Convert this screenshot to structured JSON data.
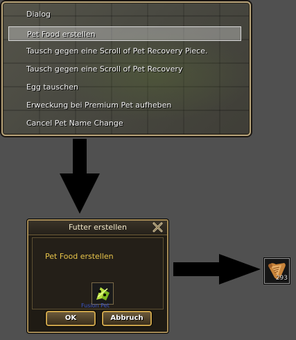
{
  "menu": {
    "items": [
      {
        "label": "Dialog",
        "selected": false
      },
      {
        "label": "Pet Food erstellen",
        "selected": true
      },
      {
        "label": "Tausch gegen eine Scroll of Pet Recovery Piece.",
        "selected": false
      },
      {
        "label": "Tausch gegen eine Scroll of Pet Recovery",
        "selected": false
      },
      {
        "label": "Egg tauschen",
        "selected": false
      },
      {
        "label": "Erweckung bei Premium Pet aufheben",
        "selected": false
      },
      {
        "label": "Cancel Pet Name Change",
        "selected": false
      }
    ]
  },
  "dialog": {
    "title": "Futter erstellen",
    "text": "Pet Food erstellen",
    "item_name": "Fusion Pet",
    "ok_label": "OK",
    "cancel_label": "Abbruch",
    "close_icon": "close-x-icon"
  },
  "result": {
    "icon": "scroll-icon",
    "count": "293"
  },
  "colors": {
    "menu_border": "#b8a47a",
    "dialog_text": "#e8c44a",
    "button_border": "#c9a24a"
  }
}
